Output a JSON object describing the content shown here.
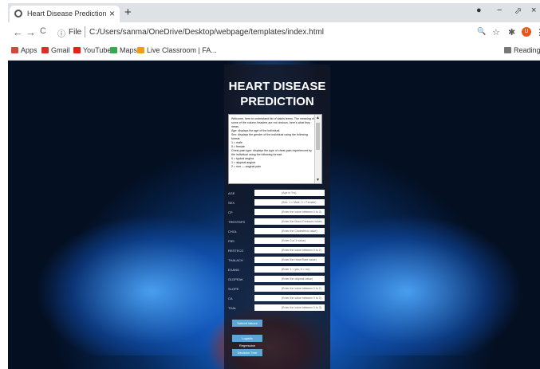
{
  "tab": {
    "title": "Heart Disease Prediction",
    "close": "×",
    "new_tab": "+"
  },
  "window_controls": {
    "status_icon": "●",
    "minimize": "−",
    "restore": "⬀",
    "close": "×"
  },
  "nav": {
    "back": "←",
    "forward": "→",
    "reload": "C"
  },
  "address": {
    "info": "ⓘ",
    "scheme_label": "File",
    "url": "C:/Users/sanma/OneDrive/Desktop/webpage/templates/index.html"
  },
  "toolbar_icons": {
    "zoom": "🔍",
    "star": "☆",
    "extensions": "✱",
    "avatar": "U",
    "menu": "⋮"
  },
  "bookmarks": [
    {
      "label": "Apps",
      "color": "#d04a3a"
    },
    {
      "label": "Gmail",
      "color": "#d93025"
    },
    {
      "label": "YouTube",
      "color": "#e62117"
    },
    {
      "label": "Maps",
      "color": "#34a853"
    },
    {
      "label": "Live Classroom | FA...",
      "color": "#f39c12"
    }
  ],
  "reading_list": "Reading lis",
  "page": {
    "title_line1": "HEART DISEASE",
    "title_line2": "PREDICTION",
    "description": "Welcome, here to understand list of data's terms. The meaning of some of the column headers are not obvious. here's what they mean,\nAge: displays the age of the individual.\nSex: displays the gender of the individual using the following format:\n1 = male\n0 = female\nChest-pain type: displays the type of chest-pain experienced by the individual using the following format:\n0 = typical angina\n1 = atypical angina\n2 = non — anginal pain",
    "fields": [
      {
        "label": "AGE",
        "placeholder": "(Age in Yrs)"
      },
      {
        "label": "SEX",
        "placeholder": "(Sex: 1 = Male, 0 = Female)"
      },
      {
        "label": "CP",
        "placeholder": "(Enter the value between 0 to 3)"
      },
      {
        "label": "TRESTBPS",
        "placeholder": "(Enter the Blood Pressure value)"
      },
      {
        "label": "CHOL",
        "placeholder": "(Enter the Cholesterol value)"
      },
      {
        "label": "FBS",
        "placeholder": "(Enter 0 or 1 value)"
      },
      {
        "label": "RESTECG",
        "placeholder": "(Enter the value between 0 to 2)"
      },
      {
        "label": "THALACH",
        "placeholder": "(Enter the Heart Rate value)"
      },
      {
        "label": "EXANG",
        "placeholder": "(Enter 1 = yes, 0 = no)"
      },
      {
        "label": "OLDPEAK",
        "placeholder": "(Enter the oldpeak value)"
      },
      {
        "label": "SLOPE",
        "placeholder": "(Enter the value between 0 to 2)"
      },
      {
        "label": "CA",
        "placeholder": "(Enter the value between 0 to 3)"
      },
      {
        "label": "THAL",
        "placeholder": "(Enter the value between 0 to 3)"
      }
    ],
    "buttons": [
      "Submit Values",
      "Logistic Regression",
      "Decision Tree"
    ]
  }
}
